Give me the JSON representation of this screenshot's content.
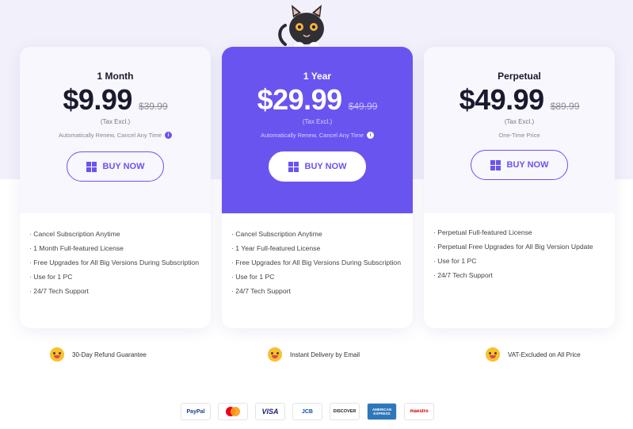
{
  "plans": [
    {
      "name": "1 Month",
      "price": "$9.99",
      "old_price": "$39.99",
      "tax": "(Tax Excl.)",
      "note": "Automatically Renew, Cancel Any Time",
      "buy_label": "BUY NOW",
      "features": [
        "· Cancel Subscription Anytime",
        "· 1 Month Full-featured License",
        "· Free Upgrades for All Big Versions During Subscription",
        "· Use for 1 PC",
        "· 24/7 Tech Support"
      ]
    },
    {
      "name": "1 Year",
      "price": "$29.99",
      "old_price": "$49.99",
      "tax": "(Tax Excl.)",
      "note": "Automatically Renew, Cancel Any Time",
      "buy_label": "BUY NOW",
      "features": [
        "· Cancel Subscription Anytime",
        "· 1 Year Full-featured License",
        "· Free Upgrades for All Big Versions During Subscription",
        "· Use for 1 PC",
        "· 24/7 Tech Support"
      ]
    },
    {
      "name": "Perpetual",
      "price": "$49.99",
      "old_price": "$89.99",
      "tax": "(Tax Excl.)",
      "note": "One-Time Price",
      "buy_label": "BUY NOW",
      "features": [
        "· Perpetual Full-featured License",
        "· Perpetual Free Upgrades for All Big Version Update",
        "· Use for 1 PC",
        "· 24/7 Tech Support"
      ]
    }
  ],
  "guarantees": [
    "30-Day Refund Guarantee",
    "Instant Delivery by Email",
    "VAT-Excluded on All Price"
  ],
  "payments": [
    "PayPal",
    "mastercard",
    "VISA",
    "JCB",
    "DISCOVER",
    "AMERICAN EXPRESS",
    "maestro"
  ],
  "info_glyph": "i",
  "colors": {
    "accent": "#6a54f0",
    "background": "#f1f0fb"
  },
  "icons": {
    "buy": "windows-icon",
    "mascot": "cat-mascot-icon",
    "guarantee": "emoji-face-icon"
  }
}
